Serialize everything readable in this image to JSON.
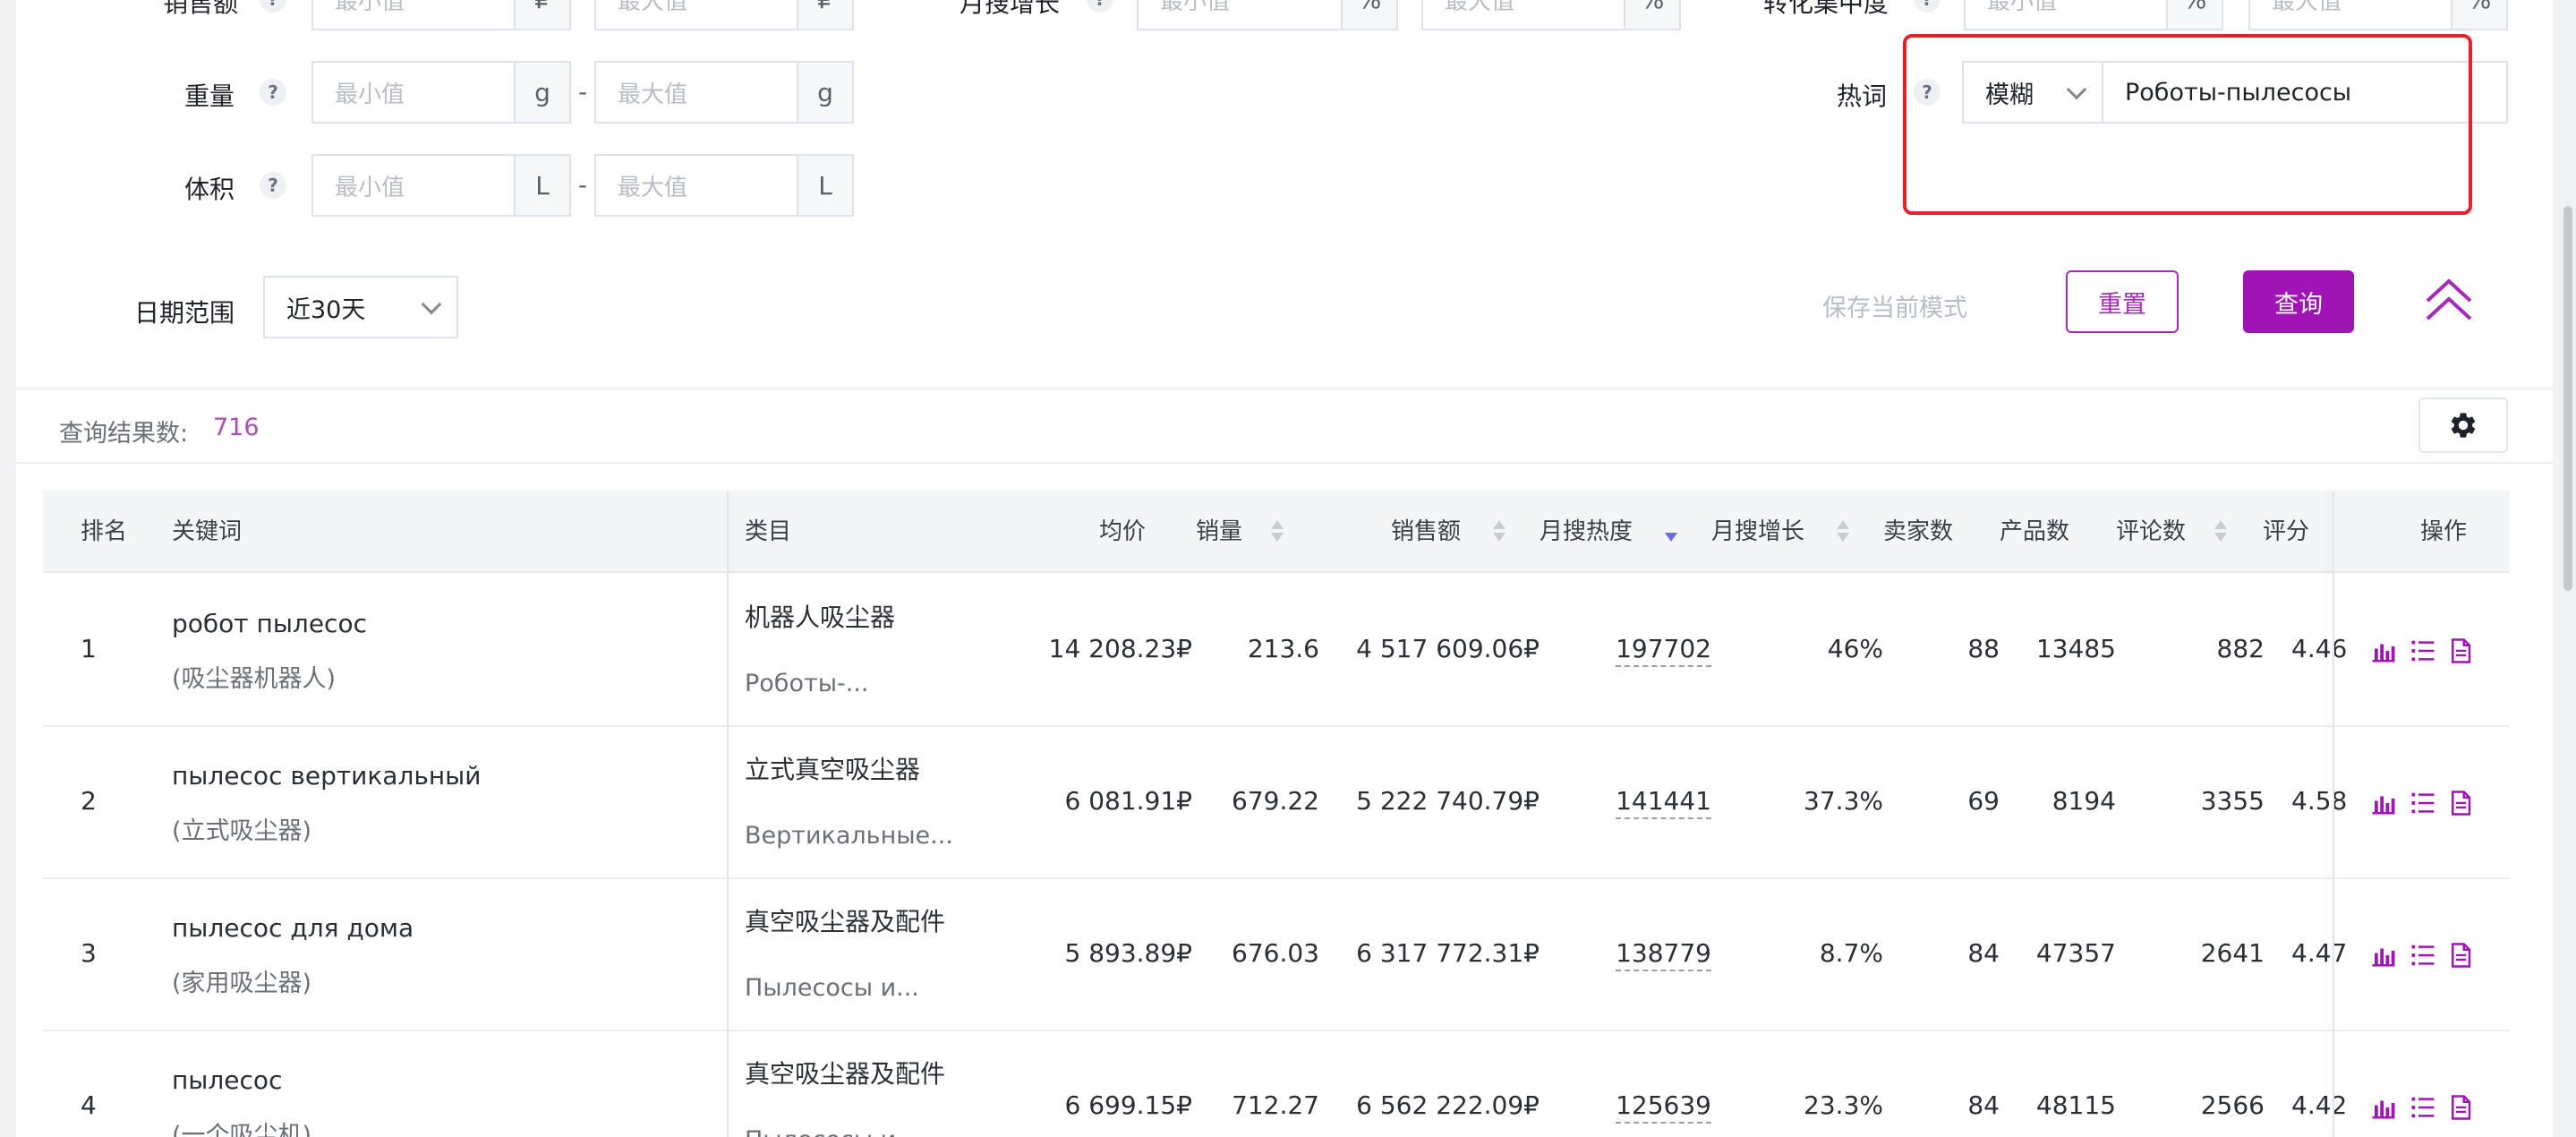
{
  "filters": {
    "top_partial": {
      "sales_label": "销售额",
      "min_ph": "最小值",
      "max_ph": "最大值",
      "unit_plus": "₽",
      "growth_label": "月搜增长",
      "pct": "%",
      "conv_label": "转化集中度"
    },
    "weight": {
      "label": "重量",
      "min_ph": "最小值",
      "max_ph": "最大值",
      "unit": "g"
    },
    "volume": {
      "label": "体积",
      "min_ph": "最小值",
      "max_ph": "最大值",
      "unit": "L"
    },
    "hotword": {
      "label": "热词",
      "match_mode": "模糊",
      "value": "Роботы-пылесосы"
    },
    "date_range": {
      "label": "日期范围",
      "value": "近30天"
    },
    "help_glyph": "?",
    "dash": "-"
  },
  "actions": {
    "save_mode": "保存当前模式",
    "reset": "重置",
    "query": "查询"
  },
  "results": {
    "count_label": "查询结果数:",
    "count": "716"
  },
  "table": {
    "headers": {
      "rank": "排名",
      "keyword": "关键词",
      "category": "类目",
      "avg_price": "均价",
      "sales": "销量",
      "revenue": "销售额",
      "monthly_search": "月搜热度",
      "monthly_growth": "月搜增长",
      "sellers": "卖家数",
      "products": "产品数",
      "reviews": "评论数",
      "rating": "评分",
      "ops": "操作"
    },
    "rows": [
      {
        "rank": "1",
        "keyword": "робот пылесос",
        "keyword_cn": "(吸尘器机器人)",
        "category": "机器人吸尘器",
        "category_ru": "Роботы-...",
        "avg_price": "14 208.23₽",
        "sales": "213.6",
        "revenue": "4 517 609.06₽",
        "monthly_search": "197702",
        "monthly_growth": "46%",
        "sellers": "88",
        "products": "13485",
        "reviews": "882",
        "rating": "4.46"
      },
      {
        "rank": "2",
        "keyword": "пылесос вертикальный",
        "keyword_cn": "(立式吸尘器)",
        "category": "立式真空吸尘器",
        "category_ru": "Вертикальные...",
        "avg_price": "6 081.91₽",
        "sales": "679.22",
        "revenue": "5 222 740.79₽",
        "monthly_search": "141441",
        "monthly_growth": "37.3%",
        "sellers": "69",
        "products": "8194",
        "reviews": "3355",
        "rating": "4.58"
      },
      {
        "rank": "3",
        "keyword": "пылесос для дома",
        "keyword_cn": "(家用吸尘器)",
        "category": "真空吸尘器及配件",
        "category_ru": "Пылесосы и...",
        "avg_price": "5 893.89₽",
        "sales": "676.03",
        "revenue": "6 317 772.31₽",
        "monthly_search": "138779",
        "monthly_growth": "8.7%",
        "sellers": "84",
        "products": "47357",
        "reviews": "2641",
        "rating": "4.47"
      },
      {
        "rank": "4",
        "keyword": "пылесос",
        "keyword_cn": "(一个吸尘机)",
        "category": "真空吸尘器及配件",
        "category_ru": "Пылесосы и...",
        "avg_price": "6 699.15₽",
        "sales": "712.27",
        "revenue": "6 562 222.09₽",
        "monthly_search": "125639",
        "monthly_growth": "23.3%",
        "sellers": "84",
        "products": "48115",
        "reviews": "2566",
        "rating": "4.42"
      }
    ]
  },
  "colors": {
    "accent": "#a013b5",
    "highlight_border": "#e8222d",
    "count_value": "#a94db8",
    "sort_active": "#6d6ee6"
  }
}
